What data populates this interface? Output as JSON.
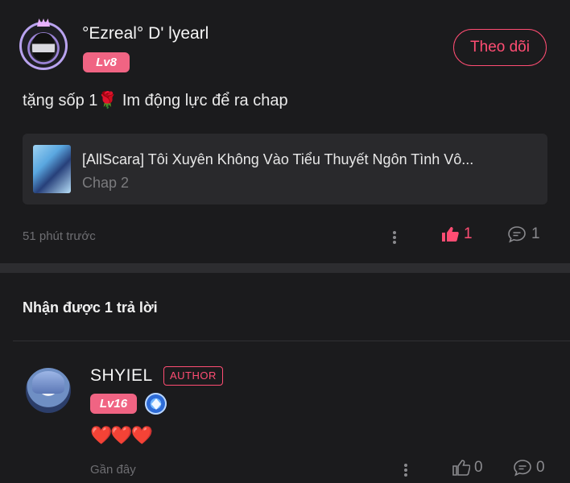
{
  "comment": {
    "username": "°Ezreal° D' lyearl",
    "level_badge": "Lv8",
    "follow_label": "Theo dõi",
    "text": "tặng sốp 1🌹 Im động lực để ra chap",
    "story": {
      "title": "[AllScara] Tôi Xuyên Không Vào Tiểu Thuyết Ngôn Tình Vô...",
      "chapter": "Chap 2"
    },
    "time": "51 phút trước",
    "likes": "1",
    "replies": "1"
  },
  "replies_section": {
    "title": "Nhận được 1 trả lời"
  },
  "reply": {
    "username": "SHYIEL",
    "author_badge": "AUTHOR",
    "level_badge": "Lv16",
    "text": "❤️❤️❤️",
    "time": "Gần đây",
    "likes": "0",
    "replies": "0"
  },
  "colors": {
    "background": "#1b1b1d",
    "accent": "#ff4d73",
    "level_badge": "#f06483",
    "muted": "#6e6e72"
  },
  "icons": [
    "more-vertical-icon",
    "thumbs-up-icon",
    "comment-bubble-icon",
    "verified-badge-icon"
  ]
}
